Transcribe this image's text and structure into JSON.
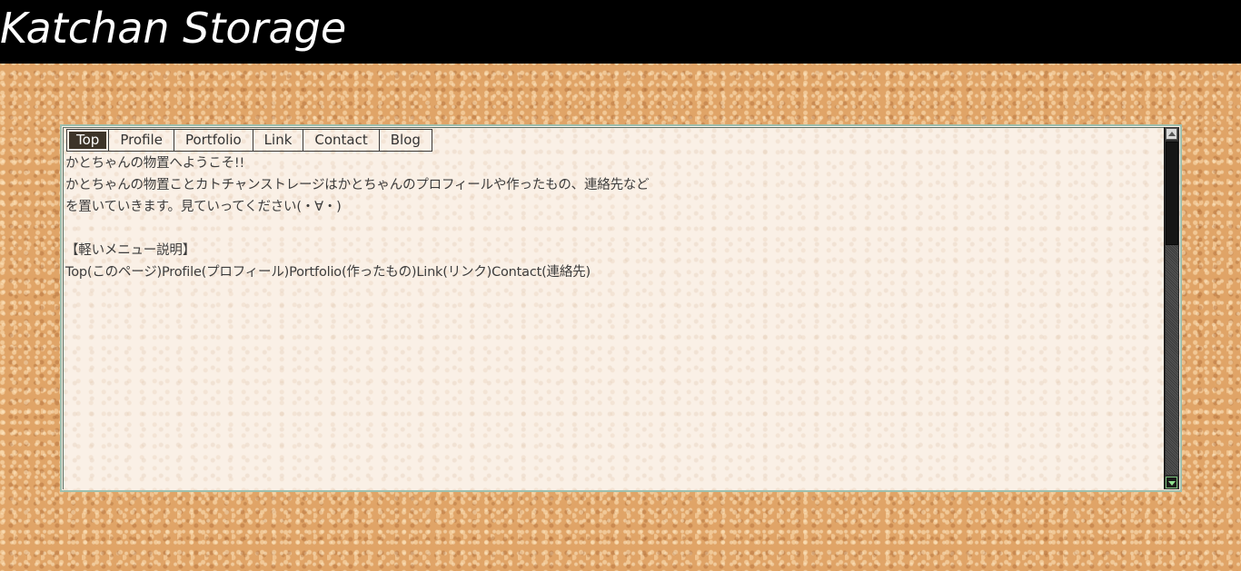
{
  "header": {
    "title": "Katchan Storage"
  },
  "nav": {
    "tabs": [
      {
        "label": "Top",
        "active": true
      },
      {
        "label": "Profile",
        "active": false
      },
      {
        "label": "Portfolio",
        "active": false
      },
      {
        "label": "Link",
        "active": false
      },
      {
        "label": "Contact",
        "active": false
      },
      {
        "label": "Blog",
        "active": false
      }
    ]
  },
  "content": {
    "line1": "かとちゃんの物置へようこそ!!",
    "line2": "かとちゃんの物置ことカトチャンストレージはかとちゃんのプロフィールや作ったもの、連絡先など",
    "line3": "を置いていきます。見ていってください(・∀・)",
    "menu_heading": "【軽いメニュー説明】",
    "menu_description": "Top(このページ)Profile(プロフィール)Portfolio(作ったもの)Link(リンク)Contact(連絡先)"
  },
  "scrollbar": {
    "up_icon": "triangle-up-icon",
    "down_icon": "triangle-down-icon"
  },
  "colors": {
    "header_bg": "#000000",
    "title_text": "#ffffff",
    "panel_bg": "#faf0e6",
    "panel_border": "#9ebfae",
    "active_tab_bg": "#3d3429",
    "cork": "#e0a467",
    "text": "#3c3c3c"
  }
}
